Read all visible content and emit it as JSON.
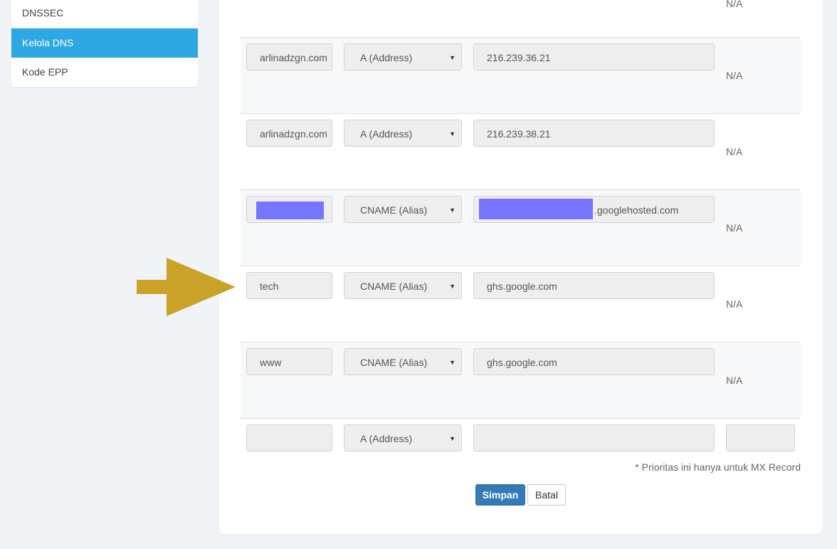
{
  "sidebar": {
    "items": [
      {
        "label": "DNSSEC",
        "active": false
      },
      {
        "label": "Kelola DNS",
        "active": true
      },
      {
        "label": "Kode EPP",
        "active": false
      }
    ]
  },
  "dns_table": {
    "top_na": "N/A",
    "rows": [
      {
        "name": "arlinadzgn.com",
        "type": "A (Address)",
        "value": "216.239.36.21",
        "priority": "N/A"
      },
      {
        "name": "arlinadzgn.com",
        "type": "A (Address)",
        "value": "216.239.38.21",
        "priority": "N/A"
      },
      {
        "name": "",
        "name_redacted": true,
        "type": "CNAME (Alias)",
        "value": ".googlehosted.com",
        "value_redacted_prefix": true,
        "priority": "N/A"
      },
      {
        "name": "tech",
        "type": "CNAME (Alias)",
        "value": "ghs.google.com",
        "priority": "N/A"
      },
      {
        "name": "www",
        "type": "CNAME (Alias)",
        "value": "ghs.google.com",
        "priority": "N/A"
      },
      {
        "name": "",
        "type": "A (Address)",
        "value": "",
        "priority": ""
      }
    ],
    "note": "* Prioritas ini hanya untuk MX Record"
  },
  "actions": {
    "save_label": "Simpan",
    "cancel_label": "Batal"
  },
  "annotation": {
    "arrow_color": "#c9a227",
    "points_to_row": "tech"
  },
  "colors": {
    "sidebar_active": "#2ea8e2",
    "save_button": "#337ab7",
    "redaction": "#7575ff"
  }
}
